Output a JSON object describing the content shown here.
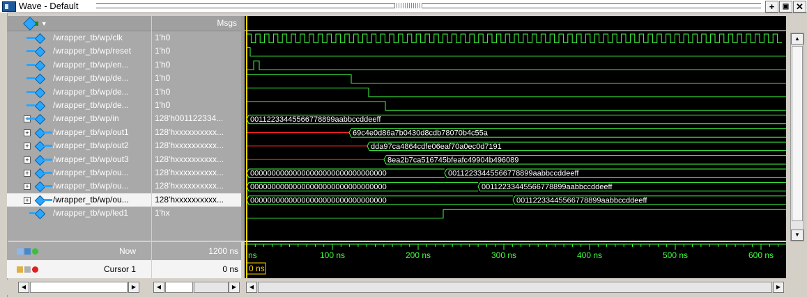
{
  "window": {
    "title": "Wave - Default"
  },
  "header": {
    "msgs_label": "Msgs"
  },
  "signals": [
    {
      "name": "/wrapper_tb/wp/clk",
      "value": "1'h0",
      "kind": "in",
      "expandable": false
    },
    {
      "name": "/wrapper_tb/wp/reset",
      "value": "1'h0",
      "kind": "in",
      "expandable": false
    },
    {
      "name": "/wrapper_tb/wp/en...",
      "value": "1'h0",
      "kind": "in",
      "expandable": false
    },
    {
      "name": "/wrapper_tb/wp/de...",
      "value": "1'h0",
      "kind": "in",
      "expandable": false
    },
    {
      "name": "/wrapper_tb/wp/de...",
      "value": "1'h0",
      "kind": "in",
      "expandable": false
    },
    {
      "name": "/wrapper_tb/wp/de...",
      "value": "1'h0",
      "kind": "in",
      "expandable": false
    },
    {
      "name": "/wrapper_tb/wp/in",
      "value": "128'h001122334...",
      "kind": "in",
      "expandable": true
    },
    {
      "name": "/wrapper_tb/wp/out1",
      "value": "128'hxxxxxxxxxx...",
      "kind": "out",
      "expandable": true
    },
    {
      "name": "/wrapper_tb/wp/out2",
      "value": "128'hxxxxxxxxxx...",
      "kind": "out",
      "expandable": true
    },
    {
      "name": "/wrapper_tb/wp/out3",
      "value": "128'hxxxxxxxxxx...",
      "kind": "out",
      "expandable": true
    },
    {
      "name": "/wrapper_tb/wp/ou...",
      "value": "128'hxxxxxxxxxx...",
      "kind": "out",
      "expandable": true
    },
    {
      "name": "/wrapper_tb/wp/ou...",
      "value": "128'hxxxxxxxxxx...",
      "kind": "out",
      "expandable": true
    },
    {
      "name": "/wrapper_tb/wp/ou...",
      "value": "128'hxxxxxxxxxx...",
      "kind": "out",
      "expandable": true,
      "selected": true
    },
    {
      "name": "/wrapper_tb/wp/led1",
      "value": "1'hx",
      "kind": "out2",
      "expandable": false
    }
  ],
  "bus_labels": {
    "in": "00112233445566778899aabbccddeeff",
    "out1": "69c4e0d86a7b0430d8cdb78070b4c55a",
    "out2": "dda97ca4864cdfe06eaf70a0ec0d7191",
    "out3": "8ea2b7ca516745bfeafc49904b496089",
    "zeros": "00000000000000000000000000000000",
    "plain": "00112233445566778899aabbccddeeff"
  },
  "timeline": {
    "now_label": "Now",
    "now_value": "1200 ns",
    "cursor_label": "Cursor 1",
    "cursor_value": "0 ns",
    "cursor_tag": "0 ns",
    "ticks": [
      "ns",
      "100 ns",
      "200 ns",
      "300 ns",
      "400 ns",
      "500 ns",
      "600 ns"
    ]
  },
  "colors": {
    "wave_green": "#40ff40",
    "undefined_red": "#ff2020",
    "cursor_yellow": "#ffd700",
    "signal_blue": "#2aa6ff"
  },
  "icons": {
    "title": "app-icon",
    "toolbar": "diamond-dropdown-icon",
    "now": "time-nav-icons",
    "cursor": "cursor-lock-icons"
  }
}
